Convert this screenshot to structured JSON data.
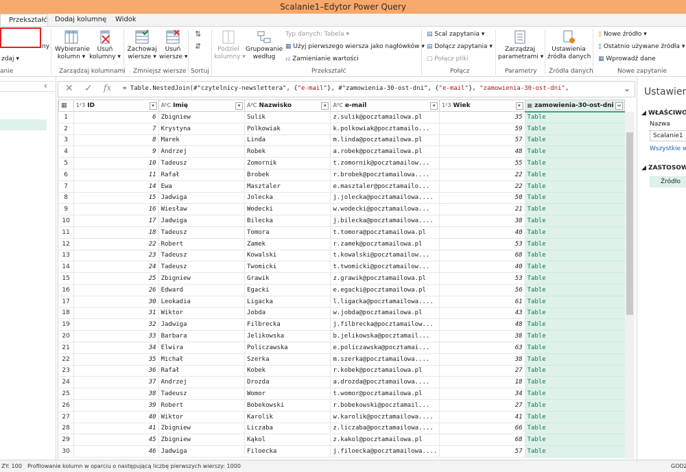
{
  "window": {
    "title": "Scalanie1–Edytor Power Query"
  },
  "tabs": [
    {
      "label": "Przekształć",
      "active": true
    },
    {
      "label": "Dodaj kolumnę",
      "active": false
    },
    {
      "label": "Widok",
      "active": false
    }
  ],
  "ribbon": {
    "left_cut": {
      "ny": "ny",
      "zdaj": "zdaj ▾",
      "anie": "anie"
    },
    "manage_columns": {
      "choose_line1": "Wybieranie",
      "choose_line2": "kolumn ▾",
      "remove_line1": "Usuń",
      "remove_line2": "kolumny ▾",
      "group": "Zarządzaj kolumnami"
    },
    "reduce_rows": {
      "keep_line1": "Zachowaj",
      "keep_line2": "wiersze ▾",
      "remove_line1": "Usuń",
      "remove_line2": "wiersze ▾",
      "group": "Zmniejsz wiersze"
    },
    "sort": {
      "group": "Sortuj"
    },
    "transform": {
      "split_line1": "Podziel",
      "split_line2": "kolumny ▾",
      "groupby_line1": "Grupowanie",
      "groupby_line2": "według",
      "datatype": "Typ danych: Tabela ▾",
      "first_row": "Użyj pierwszego wiersza jako nagłówków ▾",
      "replace": "Zamienianie wartości",
      "group": "Przekształć"
    },
    "combine": {
      "merge": "Scal zapytania ▾",
      "append": "Dołącz zapytania ▾",
      "files": "Połącz pliki",
      "group": "Połącz"
    },
    "parameters": {
      "line1": "Zarządzaj",
      "line2": "parametrami ▾",
      "group": "Parametry"
    },
    "datasources": {
      "line1": "Ustawienia",
      "line2": "źródła danych",
      "group": "Źródła danych"
    },
    "newquery": {
      "new_source": "Nowe źródło ▾",
      "recent": "Ostatnio używane źródła ▾",
      "enter": "Wprowadź dane",
      "group": "Nowe zapytanie"
    }
  },
  "formula_bar": {
    "prefix": "= Table.NestedJoin(#\"czytelnicy-newslettera\", {",
    "s1": "\"e-mail\"",
    "mid1": "}, #\"zamowienia-30-ost-dni\", {",
    "s2": "\"e-mail\"",
    "mid2": "}, ",
    "s3": "\"zamowienia-30-ost-dni\"",
    "end": ","
  },
  "columns": [
    {
      "type": "1²3",
      "name": "ID"
    },
    {
      "type": "AᴮC",
      "name": "Imię"
    },
    {
      "type": "AᴮC",
      "name": "Nazwisko"
    },
    {
      "type": "AᴮC",
      "name": "e-mail"
    },
    {
      "type": "1²3",
      "name": "Wiek"
    },
    {
      "type": "▦",
      "name": "zamowienia-30-ost-dni"
    }
  ],
  "rows": [
    [
      6,
      "Zbigniew",
      "Sulik",
      "z.sulik@pocztamailowa.pl",
      35,
      "Table"
    ],
    [
      7,
      "Krystyna",
      "Polkowiak",
      "k.polkowiak@pocztamailo...",
      59,
      "Table"
    ],
    [
      8,
      "Marek",
      "Linda",
      "m.linda@pocztamailowa.pl",
      57,
      "Table"
    ],
    [
      9,
      "Andrzej",
      "Robek",
      "a.robek@pocztamailowa.pl",
      48,
      "Table"
    ],
    [
      10,
      "Tadeusz",
      "Zomornik",
      "t.zomornik@pocztamailow...",
      55,
      "Table"
    ],
    [
      11,
      "Rafał",
      "Brobek",
      "r.brobek@pocztamailowa....",
      22,
      "Table"
    ],
    [
      14,
      "Ewa",
      "Masztaler",
      "e.masztaler@pocztamailo...",
      22,
      "Table"
    ],
    [
      15,
      "Jadwiga",
      "Jolecka",
      "j.jolecka@pocztamailowa....",
      50,
      "Table"
    ],
    [
      16,
      "Wiesław",
      "Wodecki",
      "w.wodecki@pocztamailowa...",
      21,
      "Table"
    ],
    [
      17,
      "Jadwiga",
      "Bilecka",
      "j.bilecka@pocztamailowa....",
      38,
      "Table"
    ],
    [
      18,
      "Tadeusz",
      "Tomora",
      "t.tomora@pocztamailowa.pl",
      40,
      "Table"
    ],
    [
      22,
      "Robert",
      "Zamek",
      "r.zamek@pocztamailowa.pl",
      53,
      "Table"
    ],
    [
      23,
      "Tadeusz",
      "Kowalski",
      "t.kowalski@pocztamailow...",
      68,
      "Table"
    ],
    [
      24,
      "Tadeusz",
      "Twomicki",
      "t.twomicki@pocztamailow...",
      40,
      "Table"
    ],
    [
      25,
      "Zbigniew",
      "Grawik",
      "z.grawik@pocztamailowa.pl",
      53,
      "Table"
    ],
    [
      26,
      "Edward",
      "Egacki",
      "e.egacki@pocztamailowa.pl",
      56,
      "Table"
    ],
    [
      30,
      "Leokadia",
      "Ligacka",
      "l.ligacka@pocztamailowa....",
      61,
      "Table"
    ],
    [
      31,
      "Wiktor",
      "Jobda",
      "w.jobda@pocztamailowa.pl",
      43,
      "Table"
    ],
    [
      32,
      "Jadwiga",
      "Filbrecka",
      "j.filbrecka@pocztamailow...",
      48,
      "Table"
    ],
    [
      33,
      "Barbara",
      "Jelikowska",
      "b.jelikowska@pocztamail...",
      38,
      "Table"
    ],
    [
      34,
      "Elwira",
      "Policzawska",
      "e.policzawska@pocztamai...",
      63,
      "Table"
    ],
    [
      35,
      "Michał",
      "Szerka",
      "m.szerka@pocztamailowa....",
      38,
      "Table"
    ],
    [
      36,
      "Rafał",
      "Kobek",
      "r.kobek@pocztamailowa.pl",
      27,
      "Table"
    ],
    [
      37,
      "Andrzej",
      "Drozda",
      "a.drozda@pocztamailowa....",
      18,
      "Table"
    ],
    [
      38,
      "Tadeusz",
      "Womor",
      "t.womor@pocztamailowa.pl",
      34,
      "Table"
    ],
    [
      39,
      "Robert",
      "Bobekowski",
      "r.bobekowski@pocztamail...",
      27,
      "Table"
    ],
    [
      40,
      "Wiktor",
      "Karolik",
      "w.karolik@pocztamailowa....",
      41,
      "Table"
    ],
    [
      41,
      "Zbigniew",
      "Liczaba",
      "z.liczaba@pocztamailowa....",
      66,
      "Table"
    ],
    [
      45,
      "Zbigniew",
      "Kąkol",
      "z.kakol@pocztamailowa.pl",
      68,
      "Table"
    ],
    [
      46,
      "Jadwiga",
      "Filoecka",
      "j.filoecka@pocztamailowa....",
      57,
      "Table"
    ]
  ],
  "right_panel": {
    "title": "Ustawien",
    "properties": "◢ WŁAŚCIWO",
    "name_label": "Nazwa",
    "name_value": "Scalanie1",
    "all_props": "Wszystkie wł",
    "applied": "◢ ZASTOSOW",
    "step1": "Źródło"
  },
  "status": {
    "left": "ZY: 100",
    "profiling": "Profilowanie kolumn w oparciu o następującą liczbę pierwszych wierszy: 1000",
    "right": "GODZ"
  }
}
